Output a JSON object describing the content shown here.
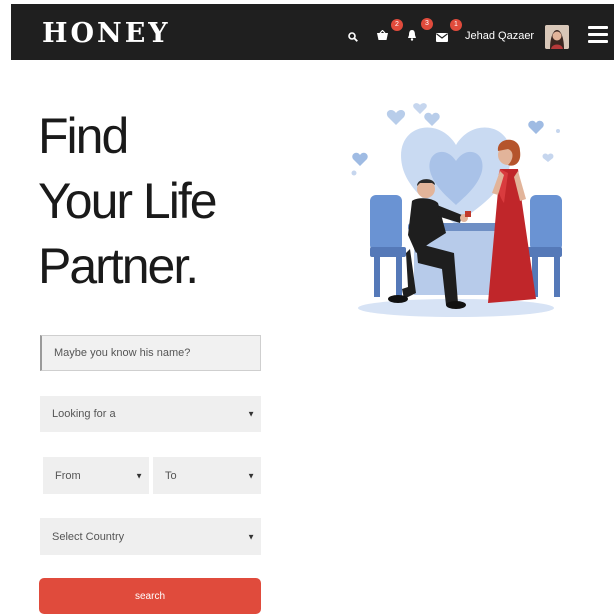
{
  "header": {
    "logo": "HONEY",
    "icons": [
      "search-icon",
      "cart-icon",
      "bell-icon",
      "mail-icon",
      "hamburger-menu-icon"
    ],
    "cart_badge": "2",
    "notifications_badge": "3",
    "messages_badge": "1",
    "user_name": "Jehad Qazaer"
  },
  "hero": {
    "headline_lines": [
      "Find",
      "Your Life",
      "Partner."
    ]
  },
  "form": {
    "name_placeholder": "Maybe you know his name?",
    "looking_for": "Looking for a",
    "from": "From",
    "to": "To",
    "country": "Select Country",
    "search_label": "search"
  },
  "colors": {
    "topbar": "#1f1f1f",
    "accent": "#e04b3c",
    "field_bg": "#efefef"
  }
}
